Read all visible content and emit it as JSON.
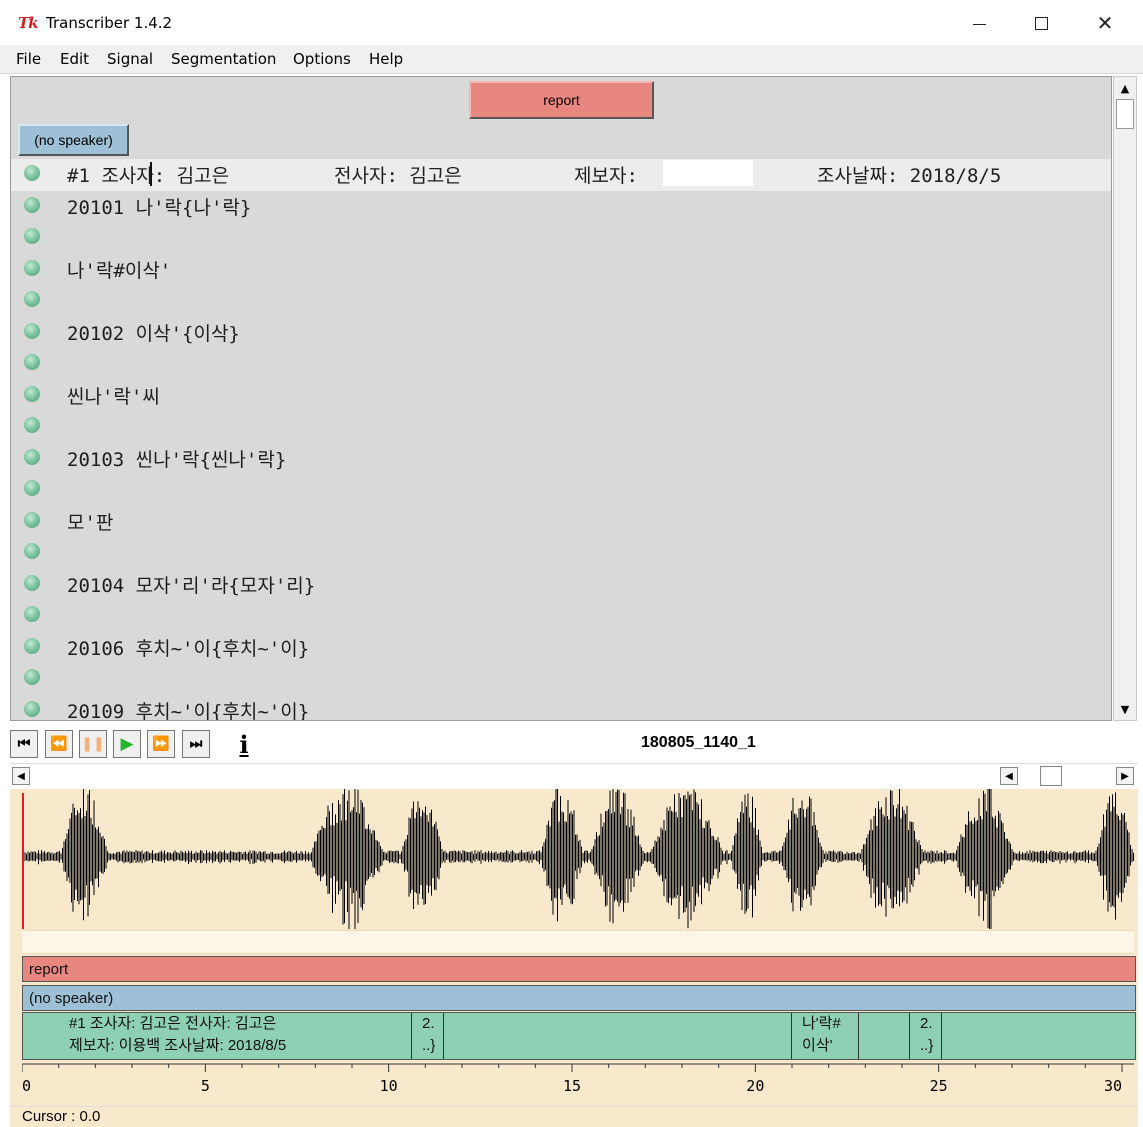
{
  "window": {
    "icon_text": "Tk",
    "title": "Transcriber 1.4.2",
    "min_icon": "minimize-icon",
    "max_icon": "maximize-icon",
    "close_icon": "close-icon",
    "close_glyph": "✕"
  },
  "menu": [
    "File",
    "Edit",
    "Signal",
    "Segmentation",
    "Options",
    "Help"
  ],
  "editor": {
    "section_label": "report",
    "speaker_label": "(no speaker)",
    "header_line": {
      "text1": "#1 조사자: 김고은",
      "text2": "전사자: 김고은",
      "text3": "제보자:",
      "text4": "조사날짜: 2018/8/5"
    },
    "lines": [
      "20101 나'락{나'락}",
      "",
      "나'락#이삭'",
      "",
      "20102 이삭'{이삭}",
      "",
      "씬나'락'씨",
      "",
      "20103 씬나'락{씬나'락}",
      "",
      "모'판",
      "",
      "20104 모자'리'라{모자'리}",
      "",
      "20106 후치~'이{후치~'이}",
      "",
      "20109 후치~'이{후치~'이}"
    ]
  },
  "scrollbar": {
    "up_glyph": "▲",
    "down_glyph": "▼"
  },
  "transport": {
    "buttons": [
      {
        "name": "go-start-button",
        "glyph": "⏮"
      },
      {
        "name": "rewind-button",
        "glyph": "⏪"
      },
      {
        "name": "pause-button",
        "glyph": "❚❚"
      },
      {
        "name": "play-button",
        "glyph": "▶"
      },
      {
        "name": "forward-button",
        "glyph": "⏩"
      },
      {
        "name": "go-end-button",
        "glyph": "⏭"
      }
    ],
    "info_glyph": "i",
    "file_name": "180805_1140_1"
  },
  "hscroll": {
    "left_glyph": "◀",
    "right_glyph": "▶"
  },
  "tracks": {
    "section": "report",
    "speaker": "(no speaker)",
    "segments": [
      {
        "line1": "#1 조사자: 김고은    전사자: 김고은",
        "line2": "제보자: 이용백    조사날짜: 2018/8/5"
      },
      {
        "line1": "2.",
        "line2": "..}"
      },
      {
        "line1": "",
        "line2": ""
      },
      {
        "line1": "나'락#",
        "line2": "이삭'"
      },
      {
        "line1": "",
        "line2": ""
      },
      {
        "line1": "2.",
        "line2": "..}"
      },
      {
        "line1": "",
        "line2": ""
      }
    ]
  },
  "axis": {
    "ticks": [
      "0",
      "5",
      "10",
      "15",
      "20",
      "25",
      "30"
    ],
    "range": [
      0,
      30
    ]
  },
  "status": {
    "cursor": "Cursor : 0.0"
  },
  "colors": {
    "section": "#e88680",
    "speaker": "#9ec0d6",
    "segment": "#8ed0b4",
    "signal_bg": "#f8e8cc",
    "cursor": "#e02020"
  }
}
